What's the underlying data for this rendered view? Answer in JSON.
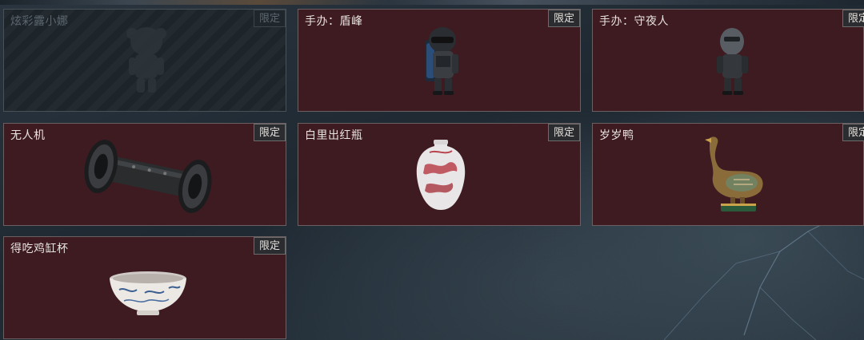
{
  "items": [
    {
      "name": "炫彩露小娜",
      "badge": "限定",
      "state": "locked",
      "icon": "figurine-girl-icon"
    },
    {
      "name": "手办：盾峰",
      "badge": "限定",
      "state": "owned",
      "icon": "figurine-shield-soldier-icon"
    },
    {
      "name": "手办：守夜人",
      "badge": "限定",
      "state": "owned",
      "icon": "figurine-nightwatcher-icon"
    },
    {
      "name": "无人机",
      "badge": "限定",
      "state": "owned",
      "icon": "drone-cylinder-icon"
    },
    {
      "name": "白里出红瓶",
      "badge": "限定",
      "state": "owned",
      "icon": "porcelain-vase-icon"
    },
    {
      "name": "岁岁鸭",
      "badge": "限定",
      "state": "owned",
      "icon": "bronze-duck-icon"
    },
    {
      "name": "得吃鸡缸杯",
      "badge": "限定",
      "state": "owned",
      "icon": "porcelain-cup-icon"
    }
  ],
  "colors": {
    "card_bg": "#3d1b21",
    "locked_bg": "#232b31",
    "badge_bg": "#2a2c2f",
    "text": "#e8e2df"
  }
}
